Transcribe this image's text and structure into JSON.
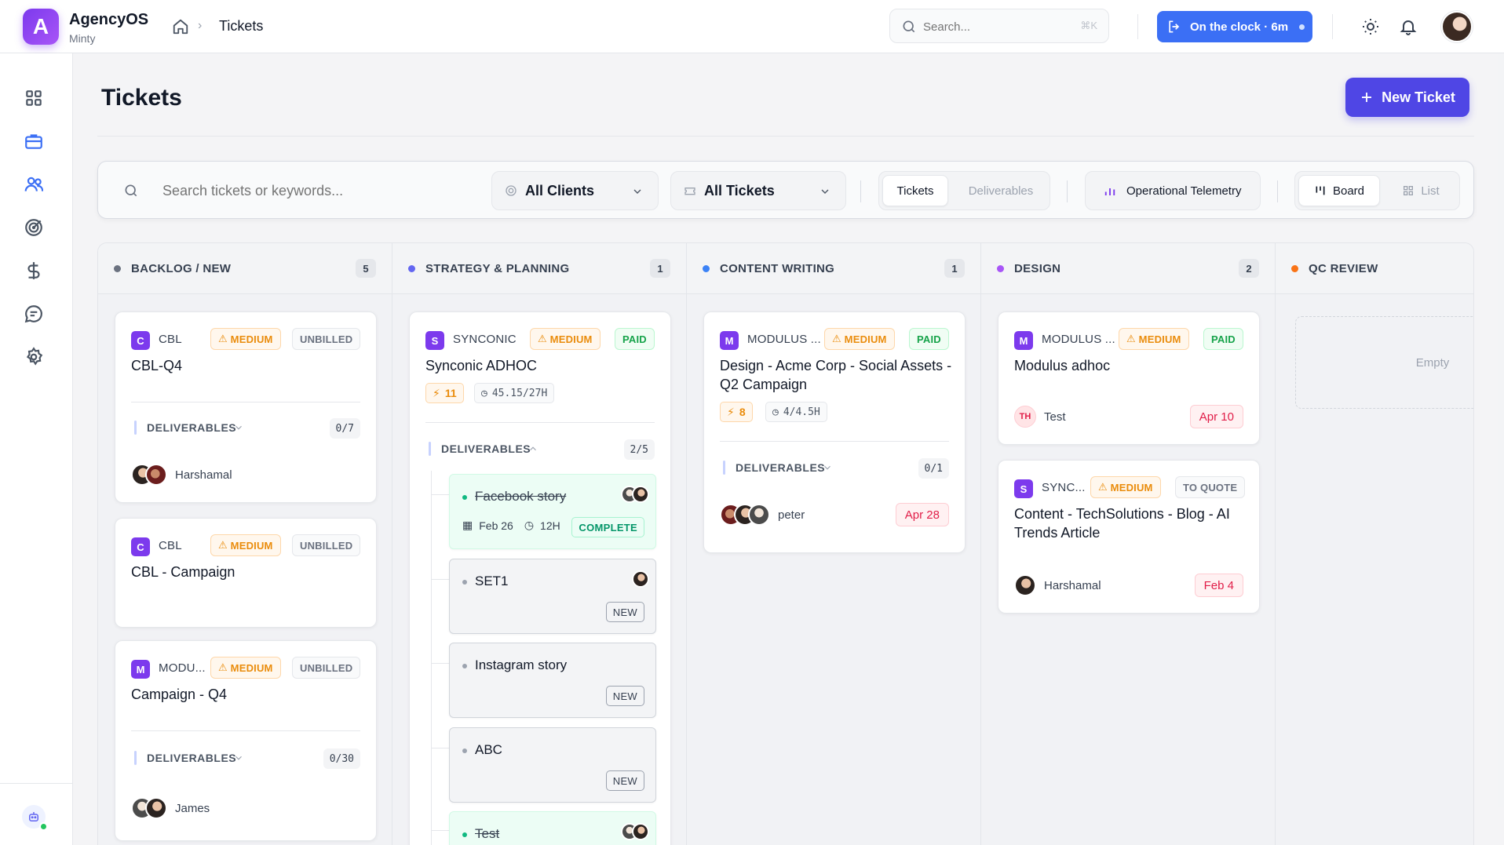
{
  "app": {
    "name": "AgencyOS",
    "workspace": "Minty",
    "logo_letter": "A"
  },
  "breadcrumb": {
    "current": "Tickets"
  },
  "search": {
    "placeholder": "Search...",
    "shortcut": "⌘K"
  },
  "clock": {
    "label": "On the clock · 6m"
  },
  "page": {
    "title": "Tickets",
    "new_ticket_label": "New Ticket"
  },
  "filters": {
    "search_placeholder": "Search tickets or keywords...",
    "clients": "All Clients",
    "tickets_filter": "All Tickets",
    "toggle": [
      "Tickets",
      "Deliverables"
    ],
    "telemetry": "Operational Telemetry",
    "views": [
      "Board",
      "List"
    ]
  },
  "columns": [
    {
      "title": "BACKLOG / NEW",
      "count": "5",
      "color": "#6b7280"
    },
    {
      "title": "STRATEGY & PLANNING",
      "count": "1",
      "color": "#6366f1"
    },
    {
      "title": "CONTENT WRITING",
      "count": "1",
      "color": "#3b82f6"
    },
    {
      "title": "DESIGN",
      "count": "2",
      "color": "#a855f7"
    },
    {
      "title": "QC REVIEW",
      "count": "",
      "color": "#f97316"
    }
  ],
  "cards": {
    "c1": {
      "badge": "C",
      "client": "CBL",
      "priority": "MEDIUM",
      "billing": "UNBILLED",
      "title": "CBL-Q4",
      "deliverables_label": "DELIVERABLES",
      "deliverables_count": "0/7",
      "owner": "Harshamal"
    },
    "c2": {
      "badge": "C",
      "client": "CBL",
      "priority": "MEDIUM",
      "billing": "UNBILLED",
      "title": "CBL - Campaign"
    },
    "c3": {
      "badge": "M",
      "client": "MODU...",
      "priority": "MEDIUM",
      "billing": "UNBILLED",
      "title": "Campaign - Q4",
      "deliverables_label": "DELIVERABLES",
      "deliverables_count": "0/30",
      "owner": "James"
    },
    "s1": {
      "badge": "S",
      "client": "SYNCONIC",
      "priority": "MEDIUM",
      "billing": "PAID",
      "title": "Synconic ADHOC",
      "points": "11",
      "hours": "45.15/27H",
      "deliverables_label": "DELIVERABLES",
      "deliverables_count": "2/5",
      "items": [
        {
          "title": "Facebook story",
          "date": "Feb 26",
          "hours": "12H",
          "status": "COMPLETE"
        },
        {
          "title": "SET1",
          "status": "NEW"
        },
        {
          "title": "Instagram story",
          "status": "NEW"
        },
        {
          "title": "ABC",
          "status": "NEW"
        },
        {
          "title": "Test"
        }
      ]
    },
    "w1": {
      "badge": "M",
      "client": "MODULUS ...",
      "priority": "MEDIUM",
      "billing": "PAID",
      "title_line1": "Design - Acme Corp - Social Assets -",
      "title_line2": "Q2 Campaign",
      "points": "8",
      "hours": "4/4.5H",
      "deliverables_label": "DELIVERABLES",
      "deliverables_count": "0/1",
      "owner": "peter",
      "due": "Apr 28"
    },
    "d1": {
      "badge": "M",
      "client": "MODULUS ...",
      "priority": "MEDIUM",
      "billing": "PAID",
      "title": "Modulus adhoc",
      "owner_initials": "TH",
      "owner": "Test",
      "due": "Apr 10"
    },
    "d2": {
      "badge": "S",
      "client": "SYNC...",
      "priority": "MEDIUM",
      "billing": "TO QUOTE",
      "title_line1": "Content - TechSolutions - Blog - AI",
      "title_line2": "Trends Article",
      "owner": "Harshamal",
      "due": "Feb 4"
    }
  },
  "qc": {
    "empty_label": "Empty"
  },
  "colors": {
    "accent": "#4f46e5",
    "clock": "#3b6ff5",
    "medium": "#ea8c0c",
    "paid": "#16a34a",
    "due": "#e11d48"
  }
}
